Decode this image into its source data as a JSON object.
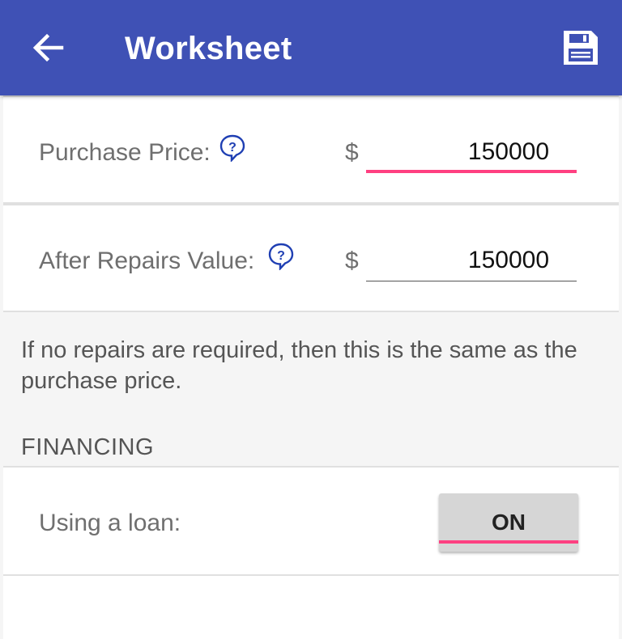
{
  "appbar": {
    "title": "Worksheet",
    "back_icon": "arrow-back-icon",
    "save_icon": "save-floppy-icon",
    "color": "#3f51b5"
  },
  "purchase_price": {
    "label": "Purchase Price:",
    "currency": "$",
    "value": "150000",
    "help_icon": "help-bubble-icon"
  },
  "after_repairs": {
    "label": "After Repairs Value:",
    "currency": "$",
    "value": "150000",
    "help_icon": "help-bubble-icon"
  },
  "helper_text": "If no repairs are required, then this is the same as the purchase price.",
  "financing": {
    "section_title": "FINANCING",
    "loan_label": "Using a loan:",
    "toggle_label": "ON",
    "accent_color": "#ff4081"
  }
}
